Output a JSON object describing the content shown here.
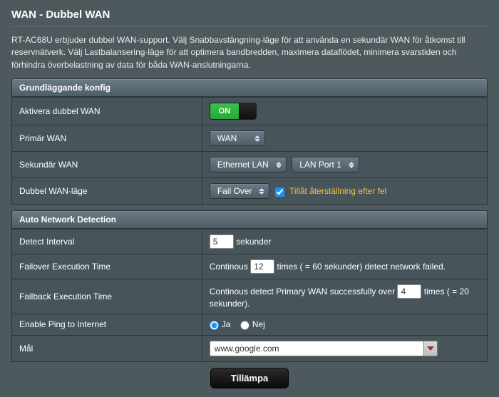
{
  "title": "WAN - Dubbel WAN",
  "description": "RT-AC68U erbjuder dubbel WAN-support. Välj Snabbavstängning-läge för att använda en sekundär WAN för åtkomst till reservnätverk. Välj Lastbalansering-läge för att optimera bandbredden, maximera dataflödet, minimera svarstiden och förhindra överbelastning av data för båda WAN-anslutningarna.",
  "sections": {
    "basic": {
      "header": "Grundläggande konfig",
      "rows": {
        "enable": {
          "label": "Aktivera dubbel WAN",
          "toggle_text": "ON"
        },
        "primary": {
          "label": "Primär WAN",
          "value": "WAN"
        },
        "secondary": {
          "label": "Sekundär WAN",
          "value1": "Ethernet LAN",
          "value2": "LAN Port 1"
        },
        "mode": {
          "label": "Dubbel WAN-läge",
          "value": "Fail Over",
          "checkbox_checked": true,
          "checkbox_label": "Tillåt återställning efter fel"
        }
      }
    },
    "autonet": {
      "header": "Auto Network Detection",
      "rows": {
        "interval": {
          "label": "Detect Interval",
          "value": "5",
          "unit": "sekunder"
        },
        "failover": {
          "label": "Failover Execution Time",
          "prefix": "Continous",
          "value": "12",
          "suffix": "times ( = 60  sekunder) detect network failed."
        },
        "failback": {
          "label": "Failback Execution Time",
          "prefix": "Continous detect Primary WAN successfully over",
          "value": "4",
          "suffix": "times ( = 20  sekunder)."
        },
        "ping": {
          "label": "Enable Ping to Internet",
          "yes": "Ja",
          "no": "Nej",
          "selected": "yes"
        },
        "target": {
          "label": "Mål",
          "value": "www.google.com"
        }
      }
    }
  },
  "apply_label": "Tillämpa"
}
